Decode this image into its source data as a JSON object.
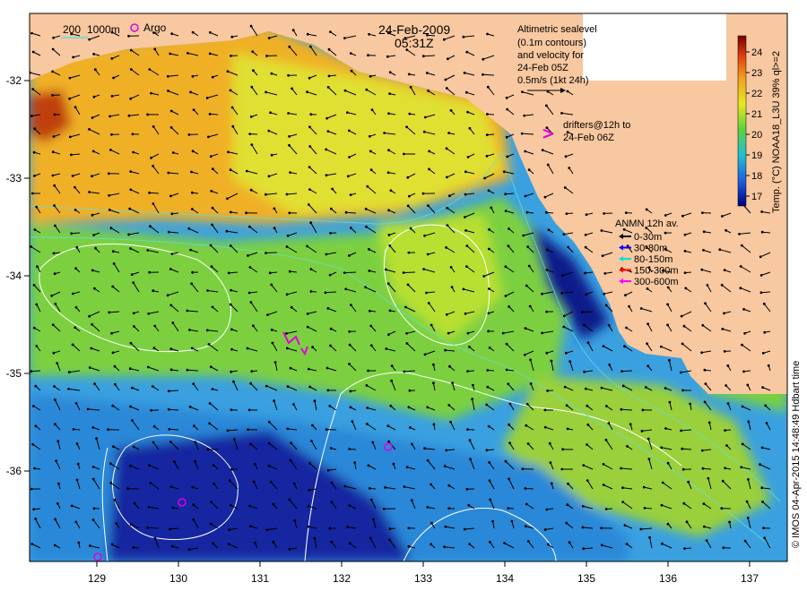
{
  "date_label": "24-Feb-2009",
  "time_label": "05:31Z",
  "bathy_legend": {
    "depth_a": "200",
    "depth_b": "1000m"
  },
  "argo_label": "Argo",
  "altimetry_note": {
    "lines": [
      "Altimetric sealevel",
      "(0.1m contours)",
      "and velocity for",
      "24-Feb 05Z",
      "0.5m/s (1kt 24h)"
    ]
  },
  "drifters_note": {
    "marker": ">",
    "lines": [
      "drifters@12h to",
      "24-Feb 06Z"
    ]
  },
  "anmn_legend": {
    "title": "ANMN 12h av.",
    "entries": [
      {
        "label": "0-30m",
        "color": "#000000"
      },
      {
        "label": "30-80m",
        "color": "#0000ff"
      },
      {
        "label": "80-150m",
        "color": "#00e0e0"
      },
      {
        "label": "150-300m",
        "color": "#ff0000"
      },
      {
        "label": "300-600m",
        "color": "#ff00ff"
      }
    ]
  },
  "colorbar": {
    "title": "Temp. (°C) NOAA18_L3U 39% ql>=2",
    "ticks": [
      "17",
      "18",
      "19",
      "20",
      "21",
      "22",
      "23",
      "24"
    ]
  },
  "credit": "© IMOS 04-Apr-2015 14:48:49 Hdbart time",
  "axes": {
    "x_ticks": [
      "129",
      "130",
      "131",
      "132",
      "133",
      "134",
      "135",
      "136",
      "137"
    ],
    "y_ticks": [
      "-32",
      "-33",
      "-34",
      "-35",
      "-36"
    ]
  },
  "colors": {
    "land": "#f8c8a0",
    "sst_warm": "#e88a20",
    "sst_mid": "#c8e020",
    "sst_cool": "#3aa0e0",
    "sst_cold": "#101a8a",
    "argo": "#e000e0",
    "contour": "#ffffff"
  }
}
